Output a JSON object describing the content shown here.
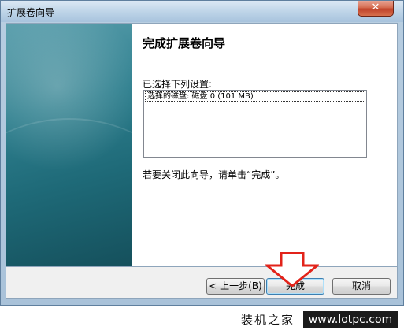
{
  "window": {
    "title": "扩展卷向导",
    "close_symbol": "✕"
  },
  "wizard": {
    "heading": "完成扩展卷向导",
    "selected_label": "已选择下列设置:",
    "settings": [
      "选择的磁盘: 磁盘 0 (101 MB)"
    ],
    "hint": "若要关闭此向导，请单击“完成”。"
  },
  "buttons": {
    "back": "< 上一步(B)",
    "finish": "完成",
    "cancel": "取消"
  },
  "watermark": {
    "name": "装机之家",
    "url": "www.lotpc.com"
  },
  "colors": {
    "accent_arrow": "#e2231a",
    "sidebar": "#2e7f8e"
  }
}
